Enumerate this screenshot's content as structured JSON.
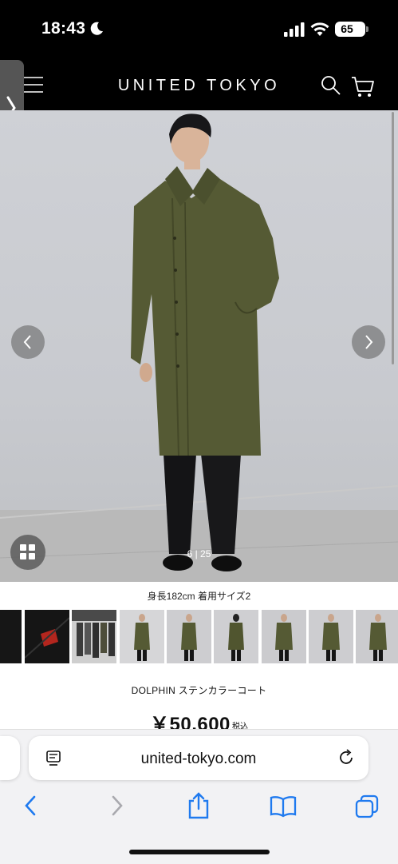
{
  "status_bar": {
    "time": "18:43",
    "battery": "65"
  },
  "header": {
    "logo": "UNITED TOKYO"
  },
  "gallery": {
    "counter": "6 | 25",
    "caption": "身長182cm 着用サイズ2"
  },
  "product": {
    "name": "DOLPHIN ステンカラーコート",
    "price": "￥50,600",
    "tax_label": "税込"
  },
  "browser": {
    "url": "united-tokyo.com"
  },
  "colors": {
    "coat": "#555a34",
    "background": "#cfd1d6",
    "accent_blue": "#1f7aef"
  }
}
